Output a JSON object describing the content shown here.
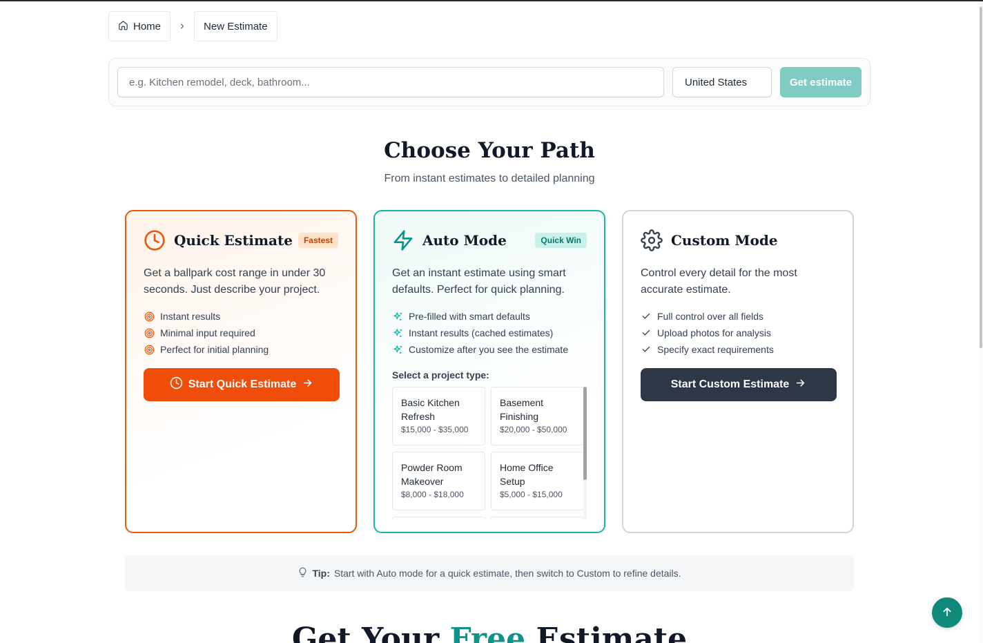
{
  "breadcrumb": {
    "home": "Home",
    "current": "New Estimate"
  },
  "search": {
    "placeholder": "e.g. Kitchen remodel, deck, bathroom...",
    "value": "",
    "country": "United States",
    "button": "Get estimate"
  },
  "section": {
    "title": "Choose Your Path",
    "subtitle": "From instant estimates to detailed planning"
  },
  "cards": {
    "quick": {
      "title": "Quick Estimate",
      "badge": "Fastest",
      "description": "Get a ballpark cost range in under 30 seconds. Just describe your project.",
      "features": [
        "Instant results",
        "Minimal input required",
        "Perfect for initial planning"
      ],
      "cta": "Start Quick Estimate",
      "icon": "clock-icon"
    },
    "auto": {
      "title": "Auto Mode",
      "badge": "Quick Win",
      "description": "Get an instant estimate using smart defaults. Perfect for quick planning.",
      "features": [
        "Pre-filled with smart defaults",
        "Instant results (cached estimates)",
        "Customize after you see the estimate"
      ],
      "project_type_label": "Select a project type:",
      "project_types": [
        {
          "name": "Basic Kitchen Refresh",
          "range": "$15,000 - $35,000"
        },
        {
          "name": "Basement Finishing",
          "range": "$20,000 - $50,000"
        },
        {
          "name": "Powder Room Makeover",
          "range": "$8,000 - $18,000"
        },
        {
          "name": "Home Office Setup",
          "range": "$5,000 - $15,000"
        }
      ],
      "icon": "lightning-icon"
    },
    "custom": {
      "title": "Custom Mode",
      "description": "Control every detail for the most accurate estimate.",
      "features": [
        "Full control over all fields",
        "Upload photos for analysis",
        "Specify exact requirements"
      ],
      "cta": "Start Custom Estimate",
      "icon": "gear-icon"
    }
  },
  "tip": {
    "label": "Tip:",
    "text": "Start with Auto mode for a quick estimate, then switch to Custom to refine details."
  },
  "bottom_heading": {
    "part1": "Get Your",
    "accent": "Free",
    "part2": "Estimate"
  },
  "colors": {
    "orange": "#ea580c",
    "teal": "#14b8a6",
    "dark": "#2d3746"
  }
}
